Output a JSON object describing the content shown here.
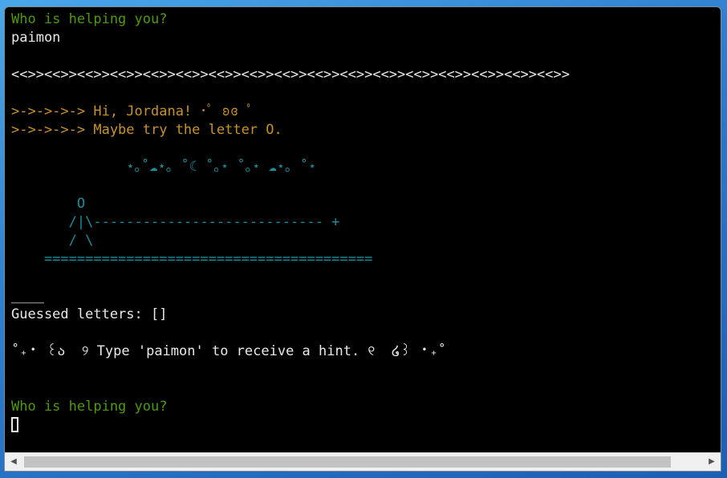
{
  "terminal": {
    "lines": [
      {
        "text": "Who is helping you?",
        "color": "green"
      },
      {
        "text": "paimon",
        "color": "white"
      },
      {
        "text": "",
        "color": "white"
      },
      {
        "text": "<<>><<>><<>><<>><<>><<>><<>><<>><<>><<>><<>><<>><<>><<>><<>><<>><<>>",
        "color": "white"
      },
      {
        "text": "",
        "color": "white"
      },
      {
        "text": ">->->->-> Hi, Jordana! ･ﾟ ʚɞ ﾟ",
        "color": "orange"
      },
      {
        "text": ">->->->-> Maybe try the letter O.",
        "color": "orange"
      },
      {
        "text": "",
        "color": "white"
      },
      {
        "text": "              ⋆｡˚☁︎⋆｡ ˚☾ ˚｡⋆ ˚｡⋆ ☁︎⋆｡ ˚⋆",
        "color": "teal"
      },
      {
        "text": "",
        "color": "white"
      },
      {
        "text": "        O",
        "color": "teal"
      },
      {
        "text": "       /|\\---------------------------- +",
        "color": "teal"
      },
      {
        "text": "       / \\",
        "color": "teal"
      },
      {
        "text": "    ========================================",
        "color": "teal"
      },
      {
        "text": "",
        "color": "white"
      },
      {
        "text": "____",
        "color": "white"
      },
      {
        "text": "Guessed letters: []",
        "color": "white"
      },
      {
        "text": "",
        "color": "white"
      },
      {
        "text": "˚₊‧ ꒰ა  ୨ Type 'paimon' to receive a hint. ୧  ໒꒱ ‧₊˚",
        "color": "white"
      },
      {
        "text": "",
        "color": "white"
      },
      {
        "text": "",
        "color": "white"
      },
      {
        "text": "Who is helping you?",
        "color": "green"
      }
    ],
    "colors": {
      "green": "#4e9a06",
      "white": "#e8e8e8",
      "orange": "#c8922b",
      "teal": "#1a8f9c",
      "background": "#000000"
    }
  },
  "scrollbar": {
    "left_arrow_icon": "arrow-left-icon",
    "right_arrow_icon": "arrow-right-icon",
    "left_arrow_glyph": "◀",
    "right_arrow_glyph": "▶"
  }
}
